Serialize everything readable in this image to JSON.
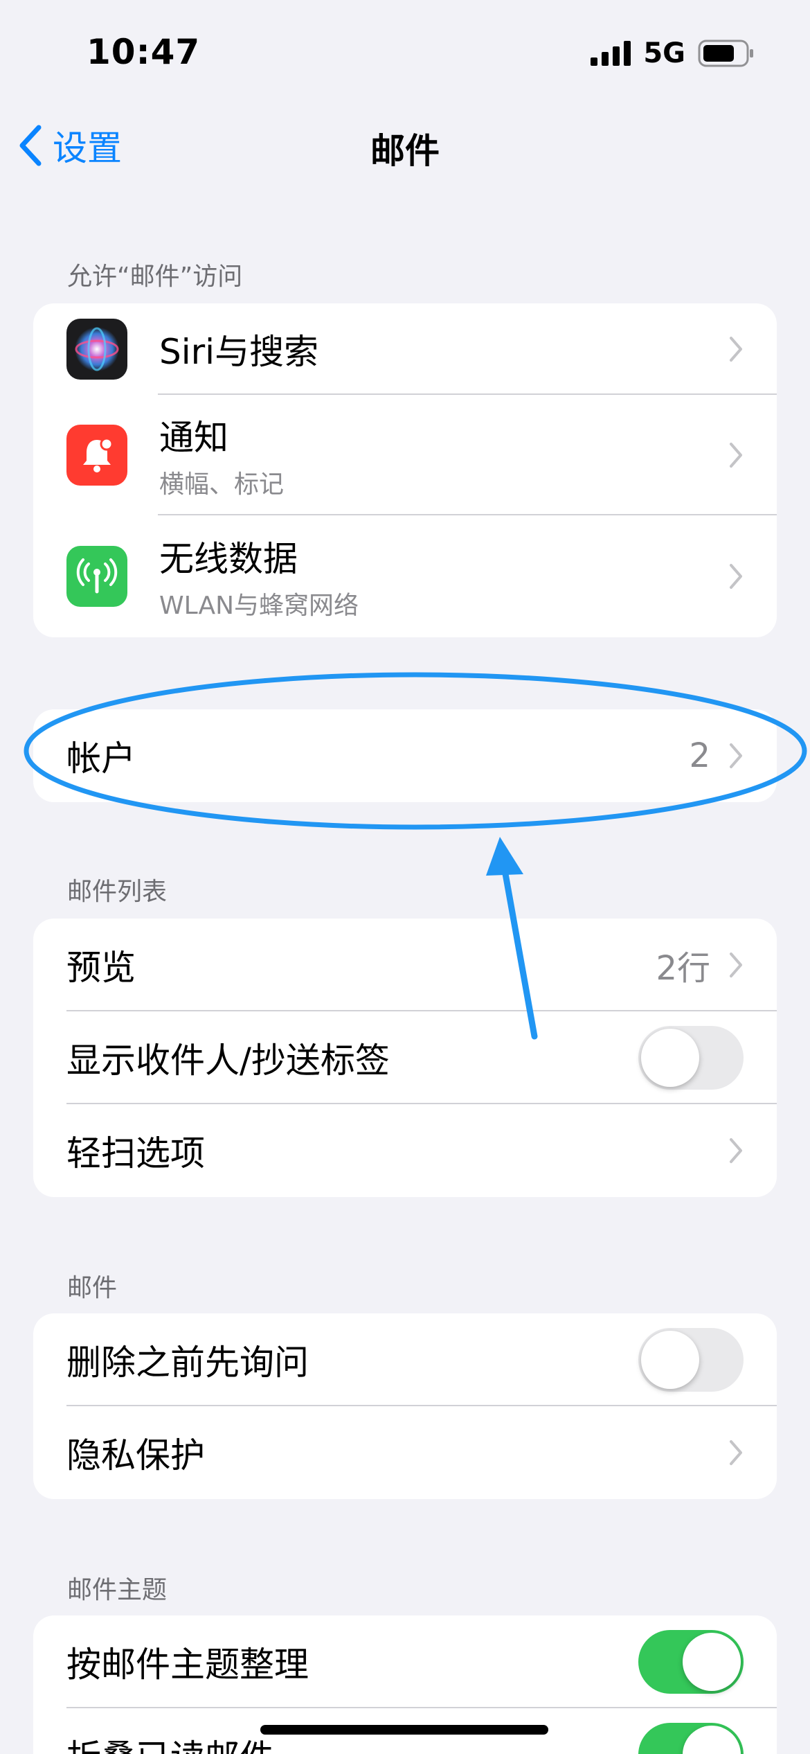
{
  "status_bar": {
    "time": "10:47",
    "network": "5G"
  },
  "nav": {
    "back_label": "设置",
    "title": "邮件"
  },
  "sections": {
    "allow_access": {
      "header": "允许“邮件”访问",
      "siri": {
        "label": "Siri与搜索"
      },
      "notifications": {
        "label": "通知",
        "subtitle": "横幅、标记"
      },
      "wireless": {
        "label": "无线数据",
        "subtitle": "WLAN与蜂窝网络"
      }
    },
    "accounts": {
      "label": "帐户",
      "value": "2"
    },
    "mail_list": {
      "header": "邮件列表",
      "preview": {
        "label": "预览",
        "value": "2行"
      },
      "show_to_cc": {
        "label": "显示收件人/抄送标签",
        "on": false
      },
      "swipe": {
        "label": "轻扫选项"
      }
    },
    "mail": {
      "header": "邮件",
      "ask_before_delete": {
        "label": "删除之前先询问",
        "on": false
      },
      "privacy": {
        "label": "隐私保护"
      }
    },
    "threading": {
      "header": "邮件主题",
      "organize_by_thread": {
        "label": "按邮件主题整理",
        "on": true
      },
      "collapse_read": {
        "label": "折叠已读邮件",
        "on": true
      }
    }
  },
  "colors": {
    "accent": "#0a84ff",
    "toggle_on": "#34c759",
    "annotation": "#2196f3",
    "siri_icon_bg": "#1c1c1e",
    "notification_icon_bg": "#ff3b30",
    "wireless_icon_bg": "#34c759"
  },
  "icons": {
    "siri": "siri-icon",
    "notifications": "bell-icon",
    "wireless": "antenna-icon",
    "chevron": "chevron-right-icon",
    "back": "chevron-left-icon"
  }
}
